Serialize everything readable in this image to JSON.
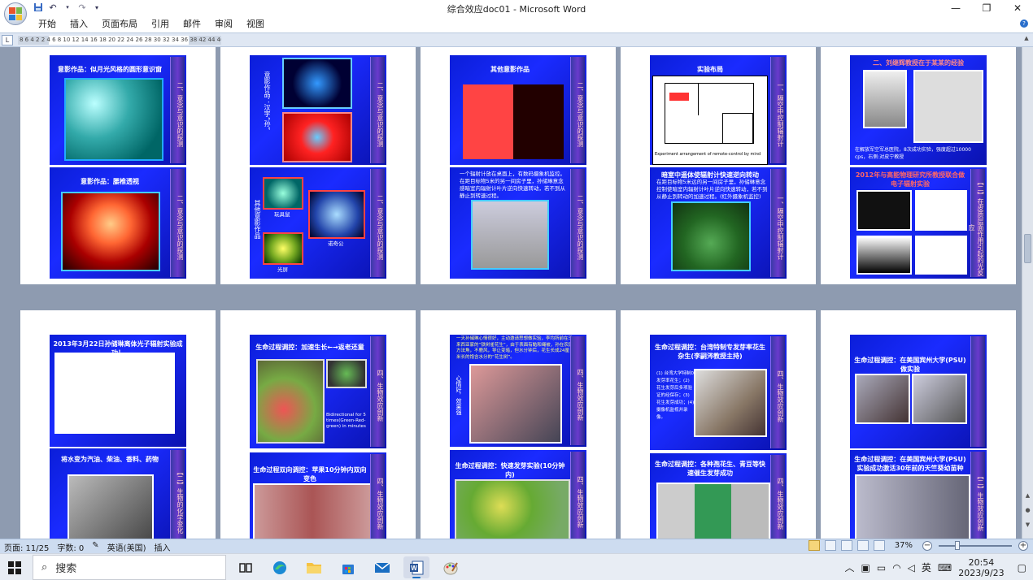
{
  "window": {
    "title": "综合效应doc01 - Microsoft Word",
    "minimize": "—",
    "maximize": "❐",
    "close": "✕"
  },
  "ribbon_tabs": [
    "开始",
    "插入",
    "页面布局",
    "引用",
    "邮件",
    "审阅",
    "视图"
  ],
  "ruler": {
    "corner": "L",
    "ticks": "8 6 4 2   2 4 6 8 10 12 14 16 18 20 22 24 26 28 30 32 34 36 38   42 44 46 48"
  },
  "pages_row1": [
    {
      "slides": [
        {
          "title": "意影作品：似月光风格的圆形意识窗",
          "side": "二、意念与意识的探测"
        },
        {
          "title": "意影作品：腰椎透视",
          "side": "二、意念与意识的探测"
        }
      ]
    },
    {
      "slides": [
        {
          "vtext": "意影作品：汉字“孙”",
          "side": "二、意念与意识的探测"
        },
        {
          "vtext": "其他意影作品",
          "labels": [
            "玩具鼠",
            "诺奇公",
            "光屏"
          ],
          "side": "二、意念与意识的探测"
        }
      ]
    },
    {
      "slides": [
        {
          "title": "其他意影作品",
          "side": "二、意念与意识的探测"
        },
        {
          "text": "一个辐射计放在桌面上，有数码摄象机监控。在距目标物5米的另一间房子里，孙储琳意念感暗室内辐射计叶片逆向快速转动，若不到从静止到转速过程。",
          "side": "二、意念与意识的探测"
        }
      ]
    },
    {
      "slides": [
        {
          "title": "实验布局",
          "caption": "Experiment arrangement of remote-control by mind",
          "side": "一、隔空中控制辐射计"
        },
        {
          "title": "暗室中遥体使辐射计快速逆向转动",
          "text": "在距目标物5米远的另一间房子里，孙储琳意念控制使暗室内辐射计叶片逆向快速转动，若不到从静止到转动的加速过程。(红外摄象机监控)",
          "side": "一、隔空中控制辐射计"
        }
      ]
    },
    {
      "slides": [
        {
          "title": "二、刘继辉教授在于某某的经验",
          "text": "在解放军空军总医院，8次成功实验，强度超过10000 cps，右侧:对皮宁教授",
          "side": ""
        },
        {
          "title": "2012年与高能物理研究所教授联合做电子辐射实验",
          "side": "【二】在皮质层面作用引起的光反应"
        }
      ]
    }
  ],
  "pages_row2": [
    {
      "slides": [
        {
          "title": "2013年3月22日孙储琳离体光子辐射实验成功！",
          "side": ""
        },
        {
          "title": "将水变为汽油、柴油、香料、药物",
          "side": "【二】生物的化学变化"
        }
      ]
    },
    {
      "slides": [
        {
          "title": "生命过程调控：加速生长←→返老还童",
          "caption": "Bidirectional for 5 times(Green-Red-green) in minutes",
          "side": "四、生物效应创新"
        },
        {
          "title": "生命过程双向调控：苹果10分钟内双向变色",
          "side": "四、生物效应创新"
        }
      ]
    },
    {
      "slides": [
        {
          "text": "一天孙储琳心情很好，主动邀请思想做实验，李均所前在马来西亚家的“铁树雀花生”，由于表面有黏和绳被，孙在农民方法角，不鹿风，导让变暗，但水分钟后，花生长成24厘米长的饱含水分的“花生树”。",
          "vtext": "心情好，效果强",
          "side": "四、生物效应创新"
        },
        {
          "title": "生命过程调控：快速发芽实验(10分钟内)",
          "side": "四、生物效应创新"
        }
      ]
    },
    {
      "slides": [
        {
          "title": "生命过程调控：台湾特制专发芽率花生杂生(李嗣涔教授主持)",
          "text": "(1) 台湾大学特制0发芽率花生；(2) 花生发芽后多项验证的经保存；(3) 花生发芽成功；(4) 摄像机监视并录像。",
          "side": "四、生物效应创新"
        },
        {
          "title": "生命过程调控：各种孢花生、青豆等快速催生发芽成功",
          "side": "四、生物效应创新"
        }
      ]
    },
    {
      "slides": [
        {
          "title": "生命过程调控：在美国宾州大学(PSU)做实验",
          "side": ""
        },
        {
          "title": "生命过程调控：在美国宾州大学(PSU)实验成功激活30年前的天竺葵幼苗种",
          "side": "【二】生物效应创新"
        }
      ]
    }
  ],
  "status": {
    "page": "页面: 11/25",
    "words": "字数: 0",
    "language": "英语(美国)",
    "mode": "插入",
    "zoom": "37%"
  },
  "taskbar": {
    "search_placeholder": "搜索",
    "ime": "英",
    "time": "20:54",
    "date": "2023/9/23"
  },
  "colors": {
    "slide_bg": "#0b1ed9",
    "doc_bg": "#8e9bb0",
    "statusbar": "#cddcf0",
    "accent": "#1b6ec2"
  }
}
